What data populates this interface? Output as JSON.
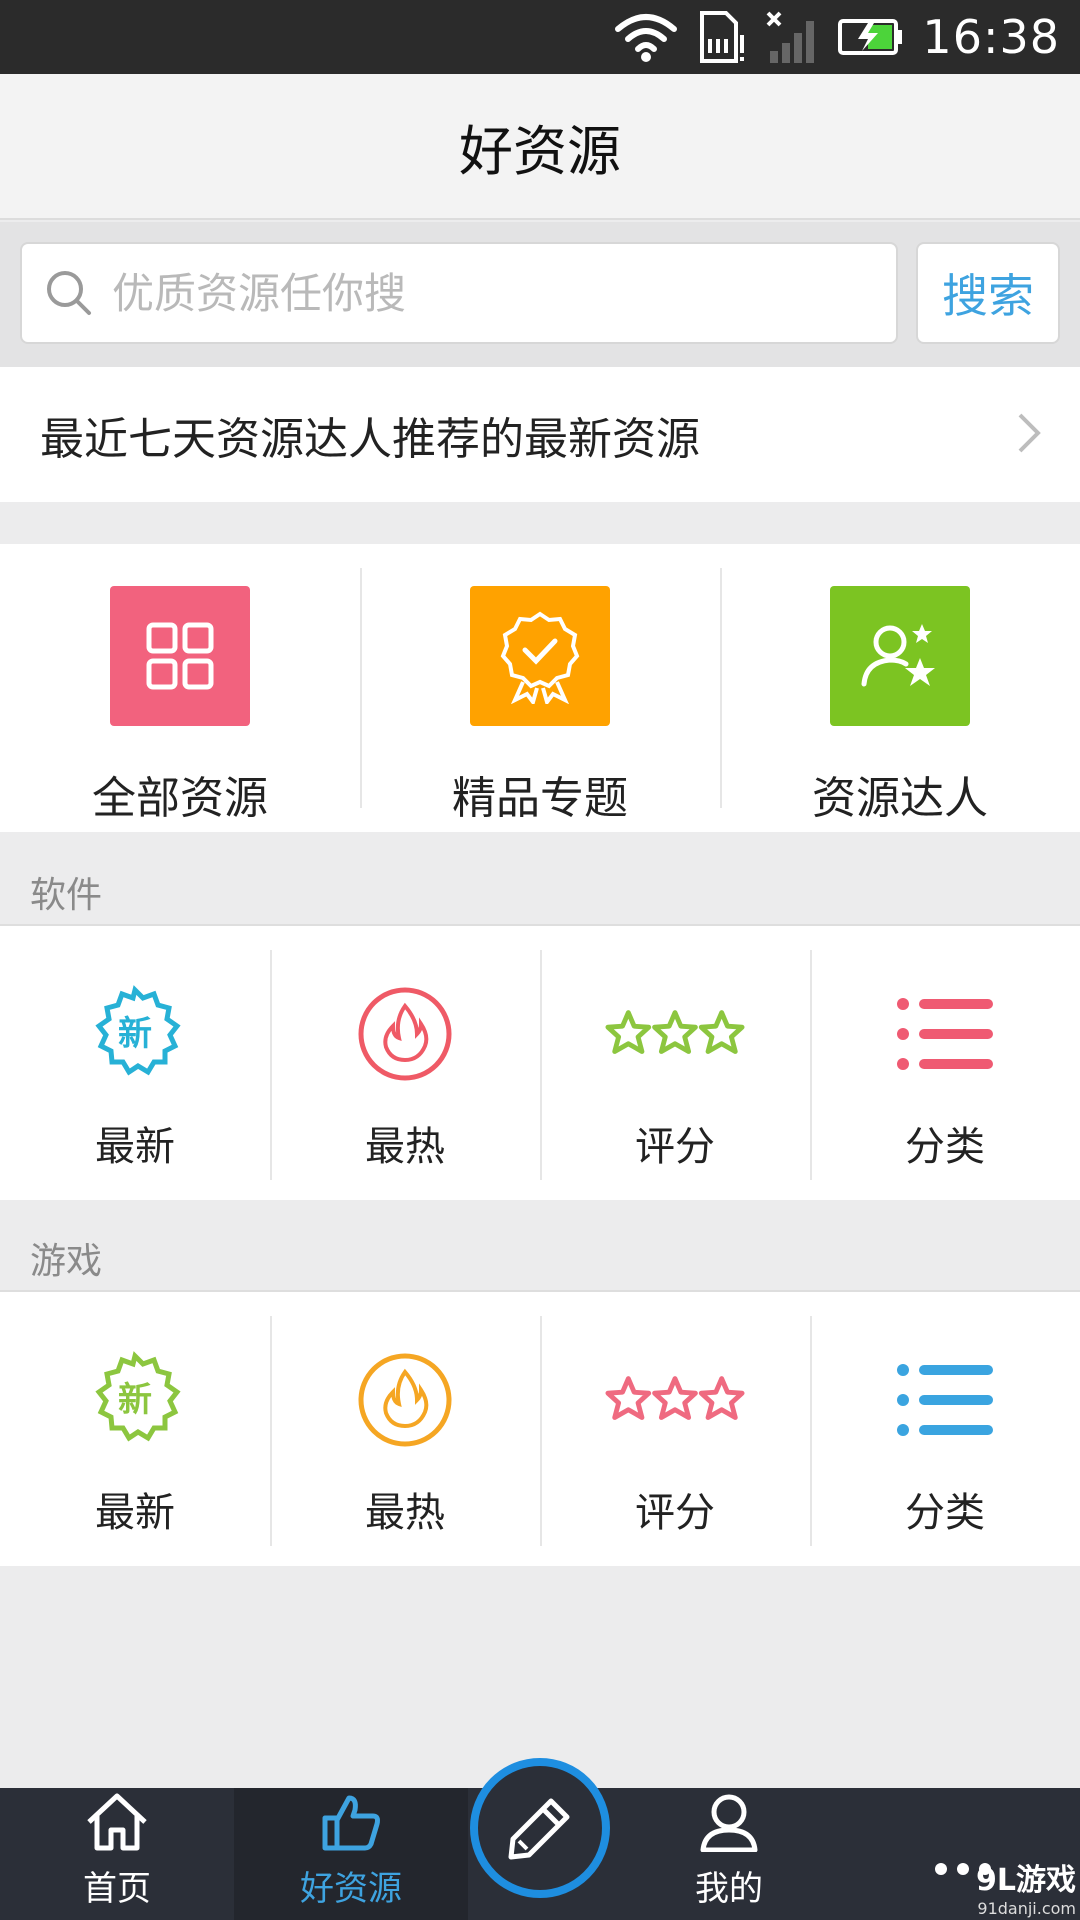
{
  "status_bar": {
    "time": "16:38"
  },
  "header": {
    "title": "好资源"
  },
  "search": {
    "placeholder": "优质资源任你搜",
    "button_label": "搜索"
  },
  "recommend": {
    "text": "最近七天资源达人推荐的最新资源"
  },
  "main_grid": [
    {
      "label": "全部资源",
      "color": "#f2627e",
      "icon": "grid-icon"
    },
    {
      "label": "精品专题",
      "color": "#ffa200",
      "icon": "badge-check-icon"
    },
    {
      "label": "资源达人",
      "color": "#7cc422",
      "icon": "user-star-icon"
    }
  ],
  "software": {
    "title": "软件",
    "items": [
      {
        "label": "最新",
        "icon": "new-badge-icon",
        "color": "#27b1d6"
      },
      {
        "label": "最热",
        "icon": "flame-icon",
        "color": "#ef5a66"
      },
      {
        "label": "评分",
        "icon": "stars-icon",
        "color": "#8cc63f"
      },
      {
        "label": "分类",
        "icon": "list-icon",
        "color": "#ef5a72"
      }
    ]
  },
  "games": {
    "title": "游戏",
    "items": [
      {
        "label": "最新",
        "icon": "new-badge-icon",
        "color": "#8cc63f"
      },
      {
        "label": "最热",
        "icon": "flame-icon",
        "color": "#f5a623"
      },
      {
        "label": "评分",
        "icon": "stars-icon",
        "color": "#ef6a80"
      },
      {
        "label": "分类",
        "icon": "list-icon",
        "color": "#3aa4e0"
      }
    ]
  },
  "tabs": [
    {
      "label": "首页",
      "icon": "home-icon"
    },
    {
      "label": "好资源",
      "icon": "thumbs-up-icon",
      "active": true
    },
    {
      "label": "我的",
      "icon": "user-icon"
    },
    {
      "label": "",
      "icon": "more-icon"
    }
  ],
  "watermark": {
    "main": "9L游戏",
    "sub": "91danji.com"
  },
  "colors": {
    "accent": "#3ea3e0",
    "tab_bg": "#2b2f38",
    "compose_ring": "#1e8ee0"
  }
}
